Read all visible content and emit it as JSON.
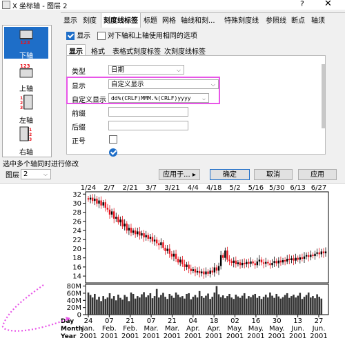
{
  "window": {
    "title": "X 坐标轴 - 图层 2",
    "help_label": "?",
    "close_label": "✕"
  },
  "tabs": [
    "显示",
    "刻度",
    "刻度线标签",
    "标题",
    "网格",
    "轴线和刻...",
    "特殊刻度线",
    "参照线",
    "断点",
    "轴须"
  ],
  "active_tab": "刻度线标签",
  "axes": [
    {
      "label": "下轴",
      "icon": "bottom-axis-icon",
      "selected": true
    },
    {
      "label": "上轴",
      "icon": "top-axis-icon",
      "selected": false
    },
    {
      "label": "左轴",
      "icon": "left-axis-icon",
      "selected": false
    },
    {
      "label": "右轴",
      "icon": "right-axis-icon",
      "selected": false
    }
  ],
  "options": {
    "show_label": "显示",
    "show_checked": true,
    "same_options_label": "对下轴和上轴使用相同的选项",
    "same_options_checked": false
  },
  "subtabs": [
    "显示",
    "格式",
    "表格式刻度标签",
    "次刻度线标签"
  ],
  "active_subtab": "显示",
  "form": {
    "type_label": "类型",
    "type_value": "日期",
    "display_label": "显示",
    "display_value": "自定义显示",
    "custom_label": "自定义显示",
    "custom_value": "dd%(CRLF)MMM.%(CRLF)yyyy",
    "prefix_label": "前缀",
    "suffix_label": "后缀",
    "plus_sign_label": "正号"
  },
  "status": {
    "message": "选中多个轴同时进行修改"
  },
  "footer": {
    "layer_label": "图层",
    "layer_value": "2",
    "apply_to_label": "应用于...",
    "ok_label": "确定",
    "cancel_label": "取消",
    "apply_label": "应用"
  },
  "colors": {
    "accent": "#1e6ec8",
    "highlight": "#e855e8",
    "up": "#000000",
    "down": "#e8141e"
  },
  "chart_data": {
    "type": "candlestick",
    "top_tick_labels": [
      "1/24",
      "2/7",
      "2/21",
      "3/7",
      "3/21",
      "4/4",
      "4/18",
      "5/2",
      "5/16",
      "5/30",
      "6/13",
      "6/27"
    ],
    "bottom_row_titles": [
      "Day",
      "Month",
      "Year"
    ],
    "bottom_ticks": [
      {
        "day": "24",
        "month": "Jan.",
        "year": "2001"
      },
      {
        "day": "07",
        "month": "Feb.",
        "year": "2001"
      },
      {
        "day": "21",
        "month": "Feb.",
        "year": "2001"
      },
      {
        "day": "07",
        "month": "Mar.",
        "year": "2001"
      },
      {
        "day": "21",
        "month": "Mar.",
        "year": "2001"
      },
      {
        "day": "04",
        "month": "Apr.",
        "year": "2001"
      },
      {
        "day": "18",
        "month": "Apr.",
        "year": "2001"
      },
      {
        "day": "02",
        "month": "May.",
        "year": "2001"
      },
      {
        "day": "16",
        "month": "May.",
        "year": "2001"
      },
      {
        "day": "30",
        "month": "May.",
        "year": "2001"
      },
      {
        "day": "13",
        "month": "Jun.",
        "year": "2001"
      },
      {
        "day": "27",
        "month": "Jun.",
        "year": "2001"
      }
    ],
    "price_axis": {
      "ticks": [
        14,
        16,
        18,
        20,
        22,
        24,
        26,
        28,
        30,
        32
      ],
      "ylim": [
        12.5,
        32.5
      ]
    },
    "volume_axis": {
      "ticks": [
        "0",
        "20M",
        "40M",
        "60M",
        "80M"
      ],
      "ylim": [
        0,
        85
      ]
    },
    "close_prices": [
      30.8,
      31.2,
      30.5,
      31.0,
      29.9,
      30.6,
      29.5,
      30.2,
      29.0,
      28.6,
      27.5,
      28.2,
      26.6,
      27.0,
      25.8,
      26.4,
      24.9,
      25.5,
      24.0,
      24.6,
      23.5,
      24.0,
      23.2,
      23.8,
      22.9,
      23.4,
      22.5,
      23.0,
      22.2,
      22.6,
      21.6,
      22.0,
      21.2,
      20.8,
      21.4,
      20.2,
      19.5,
      20.0,
      18.9,
      18.3,
      18.9,
      17.8,
      17.0,
      17.6,
      16.6,
      16.0,
      16.5,
      15.6,
      15.1,
      15.5,
      14.8,
      15.1,
      14.6,
      15.0,
      14.4,
      15.0,
      14.5,
      15.2,
      14.8,
      15.9,
      15.2,
      16.2,
      18.6,
      18.0,
      19.6,
      17.6,
      17.3,
      16.9,
      17.4,
      16.6,
      17.0,
      16.4,
      16.9,
      16.6,
      17.1,
      16.7,
      17.2,
      16.8,
      16.4,
      17.2,
      17.6,
      17.0,
      16.7,
      17.1,
      16.8,
      16.4,
      16.9,
      17.3,
      16.8,
      17.4,
      17.0,
      17.5,
      17.2,
      17.8,
      17.5,
      17.9,
      17.4,
      18.0,
      17.6,
      18.1,
      17.8,
      18.3,
      18.6,
      18.2,
      18.7,
      18.4,
      18.9,
      19.2,
      18.8,
      19.4,
      19.0,
      19.4
    ],
    "volumes": [
      62,
      55,
      48,
      58,
      42,
      50,
      38,
      52,
      44,
      48,
      60,
      45,
      52,
      40,
      56,
      47,
      42,
      55,
      50,
      38,
      62,
      58,
      45,
      52,
      48,
      57,
      63,
      49,
      54,
      60,
      46,
      52,
      72,
      48,
      55,
      61,
      50,
      44,
      58,
      53,
      47,
      62,
      56,
      49,
      52,
      45,
      58,
      60,
      43,
      50,
      55,
      48,
      66,
      52,
      47,
      53,
      59,
      44,
      50,
      62,
      80,
      57,
      49,
      54,
      46,
      52,
      58,
      48,
      44,
      56,
      51,
      47,
      53,
      60,
      45,
      52,
      49,
      55,
      58,
      47,
      52,
      44,
      50,
      56,
      48,
      62,
      53,
      47,
      58,
      51,
      45,
      49,
      55,
      60,
      47,
      52,
      56,
      48,
      53,
      61,
      44,
      50,
      55,
      62,
      48,
      52,
      46,
      57,
      50,
      45
    ]
  }
}
